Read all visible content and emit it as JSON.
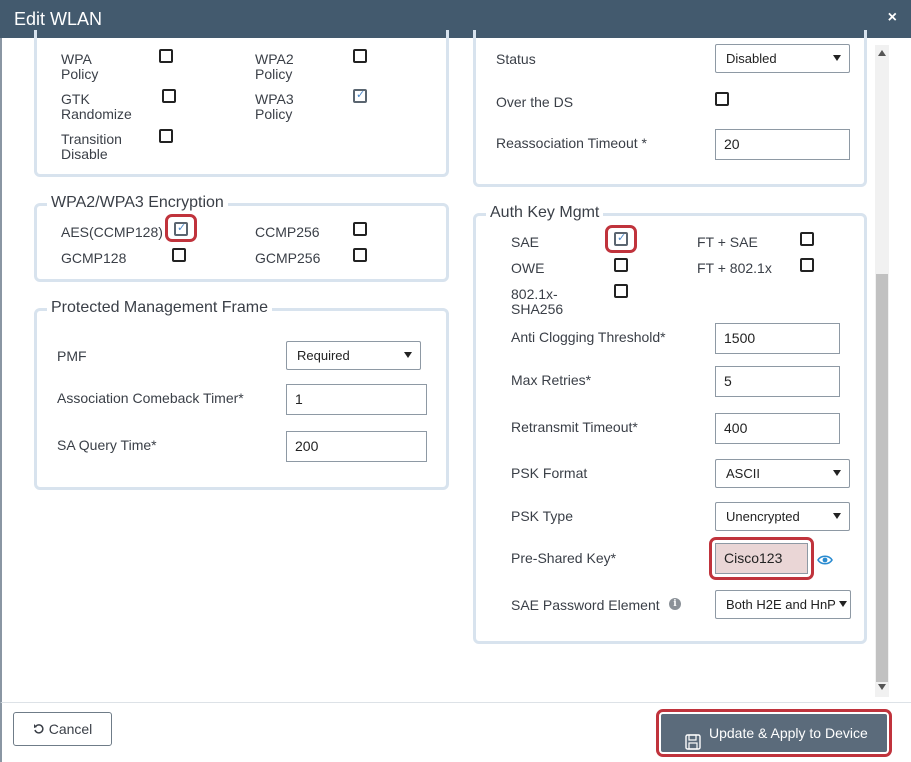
{
  "dialog": {
    "title": "Edit WLAN",
    "close_label": "×"
  },
  "security_top": {
    "wpa_policy": "WPA\nPolicy",
    "wpa2_policy": "WPA2\nPolicy",
    "gtk_randomize": "GTK\nRandomize",
    "wpa3_policy": "WPA3\nPolicy",
    "transition_disable": "Transition\nDisable"
  },
  "encryption": {
    "legend": "WPA2/WPA3 Encryption",
    "aes": "AES(CCMP128)",
    "ccmp256": "CCMP256",
    "gcmp128": "GCMP128",
    "gcmp256": "GCMP256"
  },
  "pmf": {
    "legend": "Protected Management Frame",
    "pmf_label": "PMF",
    "pmf_value": "Required",
    "comeback_label": "Association Comeback Timer*",
    "comeback_value": "1",
    "sa_query_label": "SA Query Time*",
    "sa_query_value": "200"
  },
  "fast_transition": {
    "status_label": "Status",
    "status_value": "Disabled",
    "over_ds_label": "Over the DS",
    "reassoc_label": "Reassociation Timeout *",
    "reassoc_value": "20"
  },
  "akm": {
    "legend": "Auth Key Mgmt",
    "sae": "SAE",
    "ft_sae": "FT + SAE",
    "owe": "OWE",
    "ft_8021x": "FT + 802.1x",
    "dot1x_sha256": "802.1x-\nSHA256",
    "anti_clog_label": "Anti Clogging Threshold*",
    "anti_clog_value": "1500",
    "max_retries_label": "Max Retries*",
    "max_retries_value": "5",
    "retransmit_label": "Retransmit Timeout*",
    "retransmit_value": "400",
    "psk_format_label": "PSK Format",
    "psk_format_value": "ASCII",
    "psk_type_label": "PSK Type",
    "psk_type_value": "Unencrypted",
    "psk_label": "Pre-Shared Key*",
    "psk_value": "Cisco123",
    "sae_pwe_label": "SAE Password Element",
    "sae_pwe_value": "Both H2E and HnP"
  },
  "footer": {
    "cancel_label": "Cancel",
    "apply_label": "Update & Apply to Device"
  },
  "colors": {
    "titlebar": "#435a6e",
    "highlight": "#c0333c",
    "apply_button": "#5b6b7b"
  }
}
